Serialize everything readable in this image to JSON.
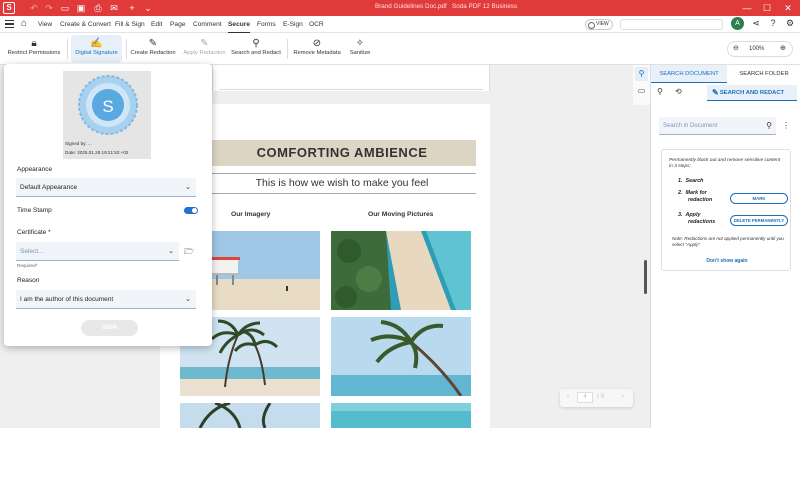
{
  "titlebar": {
    "app_logo": "S",
    "doc_title": "Brand Guidelines Doc.pdf",
    "app_title": "Soda PDF 12 Business",
    "minimize": "—",
    "maximize": "☐",
    "close": "✕"
  },
  "menubar": {
    "items": [
      "View",
      "Create & Convert",
      "Fill & Sign",
      "Edit",
      "Page",
      "Comment",
      "Secure",
      "Forms",
      "E-Sign",
      "OCR"
    ],
    "active": "Secure",
    "view_toggle": "VIEW",
    "user_initial": "A"
  },
  "ribbon": {
    "tools": [
      {
        "label": "Restrict Permissions",
        "icon": "lock-icon"
      },
      {
        "label": "Digital Signature",
        "icon": "signature-icon"
      },
      {
        "label": "Create Redaction",
        "icon": "redaction-icon"
      },
      {
        "label": "Apply Redaction",
        "icon": "apply-redaction-icon"
      },
      {
        "label": "Search and Redact",
        "icon": "search-icon"
      },
      {
        "label": "Remove Metadata",
        "icon": "remove-metadata-icon"
      },
      {
        "label": "Sanitize",
        "icon": "sanitize-icon"
      }
    ],
    "zoom": "100%",
    "zoom_out": "⊖",
    "zoom_in": "⊕"
  },
  "document": {
    "banner": "COMFORTING AMBIENCE",
    "subtitle": "This is how we wish to make you feel",
    "col1_heading": "Our Imagery",
    "col2_heading": "Our Moving Pictures"
  },
  "pager": {
    "prev": "‹",
    "current": "4",
    "sep": "/",
    "total": "5",
    "next": "›"
  },
  "signature": {
    "signed_by": "Signed by: ...",
    "date": "Date: 2025.01.28 19:21:53 +02",
    "appearance_label": "Appearance",
    "appearance_value": "Default Appearance",
    "timestamp_label": "Time Stamp",
    "timestamp_on": true,
    "certificate_label": "Certificate *",
    "certificate_placeholder": "Select...",
    "required_text": "Required*",
    "reason_label": "Reason",
    "reason_value": "I am the author of this document",
    "sign_button": "SIGN"
  },
  "panel": {
    "tab_search_document": "SEARCH DOCUMENT",
    "tab_search_folder": "SEARCH FOLDER",
    "subtab_search_redact": "SEARCH AND REDACT",
    "search_placeholder": "Search in Document",
    "intro": "Permanently black out and remove sensitive content in 3 steps:",
    "step1_num": "1.",
    "step1": "Search",
    "step2_num": "2.",
    "step2_line1": "Mark for",
    "step2_line2": "redaction",
    "step3_num": "3.",
    "step3_line1": "Apply",
    "step3_line2": "redactions",
    "mark_button": "MARK",
    "delete_button": "DELETE PERMANENTLY",
    "note": "Note: Redactions are not applied permanently until you select \"Apply\"",
    "dont_show": "Don't show again"
  },
  "colors": {
    "brand_red": "#e13a3a",
    "accent_blue": "#1d6fb8",
    "banner_beige": "#ddd5c3"
  }
}
